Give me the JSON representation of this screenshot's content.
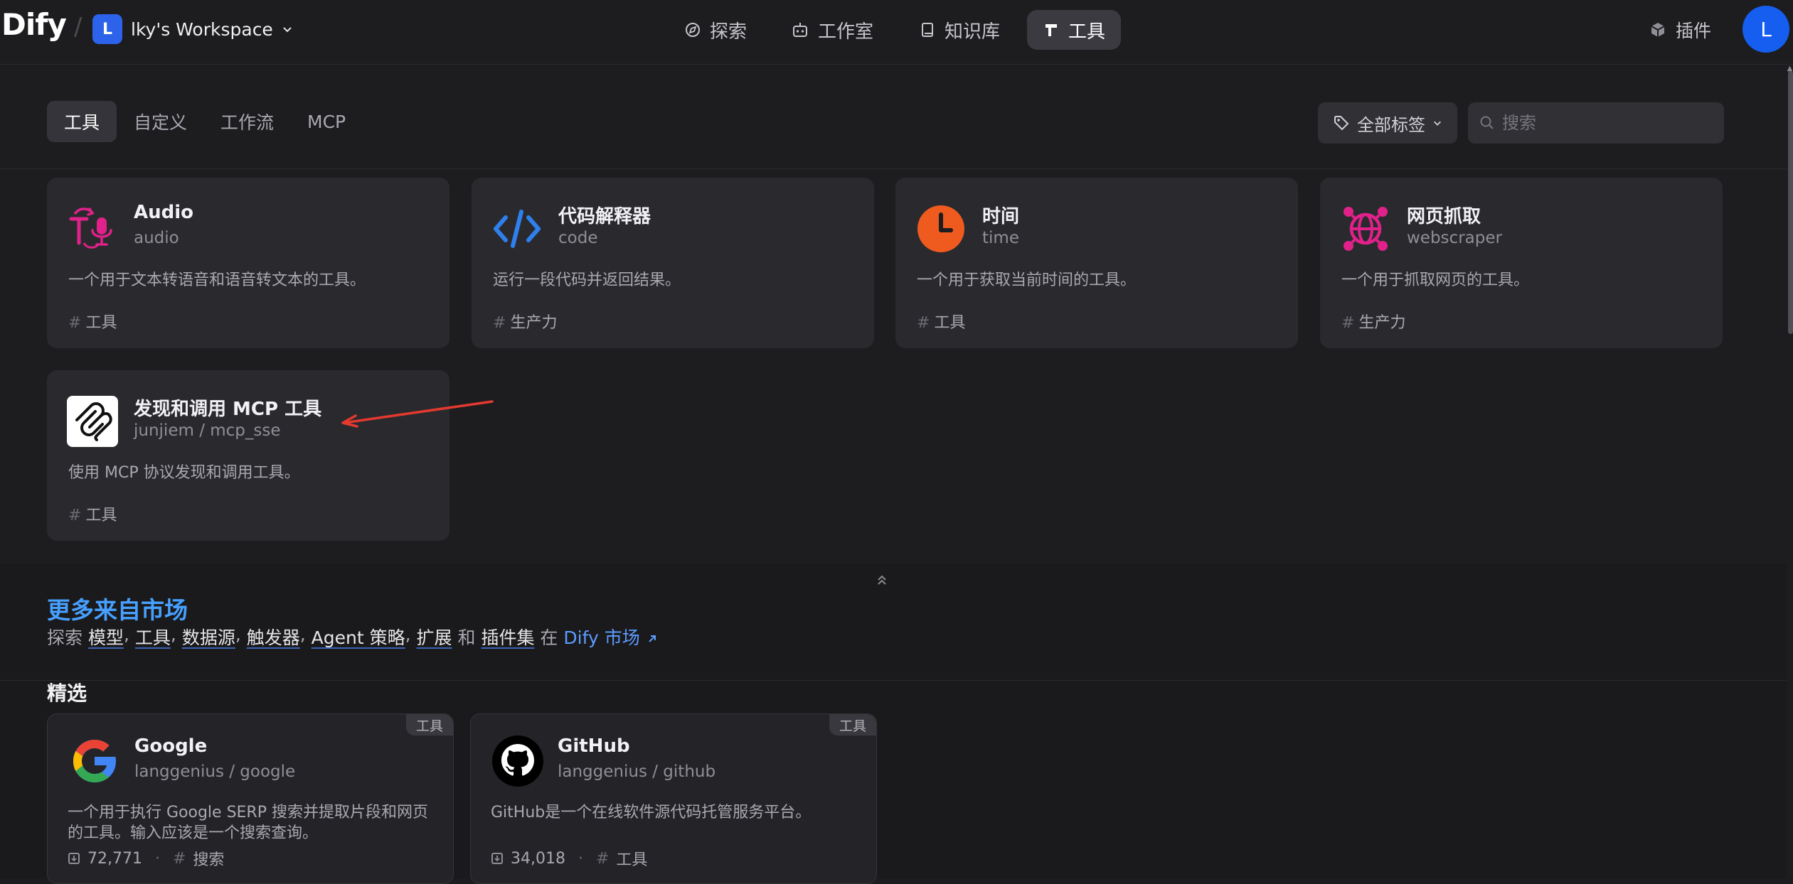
{
  "app": {
    "logo": "Dify",
    "separator": "/"
  },
  "workspace": {
    "avatar_letter": "L",
    "name": "lky's Workspace"
  },
  "nav": {
    "explore": "探索",
    "studio": "工作室",
    "knowledge": "知识库",
    "tools": "工具",
    "plugins": "插件",
    "user_letter": "L"
  },
  "tabs": {
    "tools": "工具",
    "custom": "自定义",
    "workflow": "工作流",
    "mcp": "MCP"
  },
  "filter": {
    "tags_label": "全部标签",
    "search_placeholder": "搜索"
  },
  "tools": [
    {
      "title": "Audio",
      "sub": "audio",
      "desc": "一个用于文本转语音和语音转文本的工具。",
      "tag": "工具",
      "icon": "audio-tts-icon"
    },
    {
      "title": "代码解释器",
      "sub": "code",
      "desc": "运行一段代码并返回结果。",
      "tag": "生产力",
      "icon": "code-icon"
    },
    {
      "title": "时间",
      "sub": "time",
      "desc": "一个用于获取当前时间的工具。",
      "tag": "工具",
      "icon": "clock-icon"
    },
    {
      "title": "网页抓取",
      "sub": "webscraper",
      "desc": "一个用于抓取网页的工具。",
      "tag": "生产力",
      "icon": "globe-network-icon"
    },
    {
      "title": "发现和调用 MCP 工具",
      "sub": "junjiem / mcp_sse",
      "desc": "使用 MCP 协议发现和调用工具。",
      "tag": "工具",
      "icon": "mcp-icon"
    }
  ],
  "marketplace": {
    "title": "更多来自市场",
    "prefix": "探索",
    "links": [
      "模型",
      "工具",
      "数据源",
      "触发器",
      "Agent 策略",
      "扩展"
    ],
    "and": "和",
    "last_link": "插件集",
    "in": "在",
    "dify_market": "Dify 市场",
    "featured": "精选"
  },
  "featured": [
    {
      "title": "Google",
      "sub": "langgenius / google",
      "desc": "一个用于执行 Google SERP 搜索并提取片段和网页的工具。输入应该是一个搜索查询。",
      "downloads": "72,771",
      "tag": "搜索",
      "badge": "工具",
      "icon": "google-icon"
    },
    {
      "title": "GitHub",
      "sub": "langgenius / github",
      "desc": "GitHub是一个在线软件源代码托管服务平台。",
      "downloads": "34,018",
      "tag": "工具",
      "badge": "工具",
      "icon": "github-icon"
    }
  ],
  "colors": {
    "accent": "#155eef",
    "market_title": "#47a0ff",
    "annotation_arrow": "#e5392f"
  }
}
